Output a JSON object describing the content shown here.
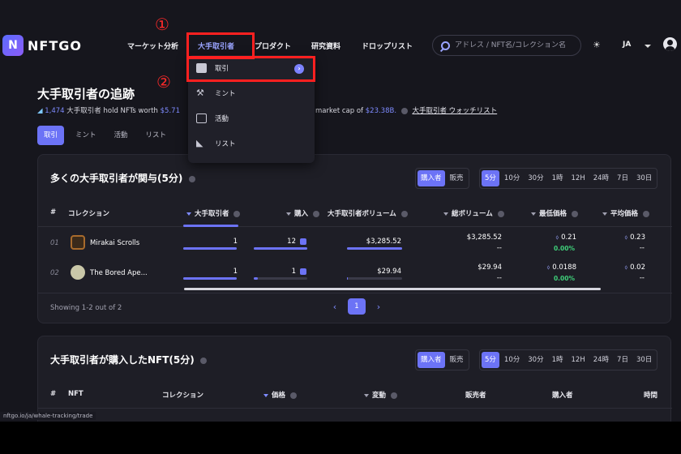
{
  "nav": {
    "logo_text": "NFTGO",
    "items": [
      "マーケット分析",
      "大手取引者",
      "プロダクト",
      "研究資料",
      "ドロップリスト"
    ],
    "search_placeholder": "アドレス / NFT名/コレクション名",
    "lang": "JA"
  },
  "annotations": {
    "one": "①",
    "two": "②"
  },
  "dropdown": {
    "items": [
      {
        "label": "取引",
        "icon": "trade-icon"
      },
      {
        "label": "ミント",
        "icon": "mint-icon"
      },
      {
        "label": "活動",
        "icon": "activity-icon"
      },
      {
        "label": "リスト",
        "icon": "list-icon"
      }
    ],
    "go_symbol": "›"
  },
  "header": {
    "title": "大手取引者の追跡",
    "whale_count": "1,474",
    "summary_text": "大手取引者 hold NFTs worth",
    "worth_value": "$5.71",
    "market_cap_text": "market cap of",
    "market_cap_value": "$23.38B.",
    "watchlist_link": "大手取引者 ウォッチリスト"
  },
  "tabs": [
    "取引",
    "ミント",
    "活動",
    "リスト"
  ],
  "card1": {
    "title": "多くの大手取引者が関与(5分)",
    "side_filter": [
      "購入者",
      "販売"
    ],
    "time_filter": [
      "5分",
      "10分",
      "30分",
      "1時",
      "12H",
      "24時",
      "7日",
      "30日"
    ],
    "headers": {
      "idx": "#",
      "collection": "コレクション",
      "whales": "大手取引者",
      "buys": "購入",
      "whale_volume": "大手取引者ボリューム",
      "total_volume": "総ボリューム",
      "floor": "最低価格",
      "avg": "平均価格"
    },
    "rows": [
      {
        "idx": "01",
        "name": "Mirakai Scrolls",
        "whales": "1",
        "buys": "12",
        "whale_volume": "$3,285.52",
        "total_volume": "$3,285.52",
        "total_sub": "--",
        "floor": "0.21",
        "floor_change": "0.00%",
        "avg": "0.23",
        "avg_sub": "--",
        "whales_frac": 1.0,
        "buys_frac": 1.0,
        "volume_frac": 1.0
      },
      {
        "idx": "02",
        "name": "The Bored Ape...",
        "whales": "1",
        "buys": "1",
        "whale_volume": "$29.94",
        "total_volume": "$29.94",
        "total_sub": "--",
        "floor": "0.0188",
        "floor_change": "0.00%",
        "avg": "0.02",
        "avg_sub": "--",
        "whales_frac": 1.0,
        "buys_frac": 0.08,
        "volume_frac": 0.01
      }
    ],
    "showing": "Showing 1-2 out of 2",
    "page": "1"
  },
  "card2": {
    "title": "大手取引者が購入したNFT(5分)",
    "side_filter": [
      "購入者",
      "販売"
    ],
    "time_filter": [
      "5分",
      "10分",
      "30分",
      "1時",
      "12H",
      "24時",
      "7日",
      "30日"
    ],
    "headers": {
      "idx": "#",
      "nft": "NFT",
      "collection": "コレクション",
      "price": "価格",
      "change": "変動",
      "seller": "販売者",
      "buyer": "購入者",
      "time": "時間"
    }
  },
  "status_url": "nftgo.io/ja/whale-tracking/trade",
  "colors": {
    "accent": "#6c73f6",
    "positive": "#3fd07a",
    "annotation": "#ff2020"
  }
}
